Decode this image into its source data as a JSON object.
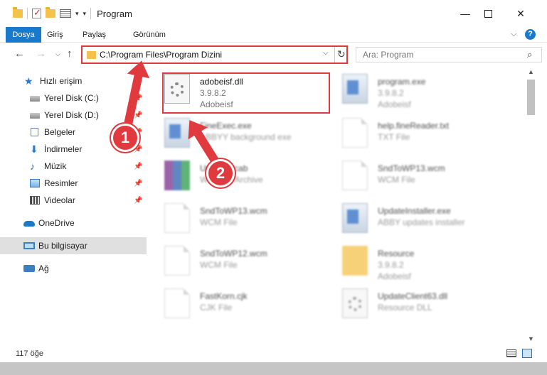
{
  "window": {
    "title": "Program",
    "controls": {
      "minimize": "—",
      "maximize": "",
      "close": "✕"
    }
  },
  "ribbon": {
    "tabs": [
      "Dosya",
      "Giriş",
      "Paylaş",
      "Görünüm"
    ],
    "collapse": "⌵",
    "help": "?"
  },
  "nav": {
    "back": "←",
    "forward": "→",
    "history": "⌵",
    "up": "↑",
    "address": "C:\\Program Files\\Program Dizini",
    "address_dropdown": "⌵",
    "refresh": "↻",
    "search_placeholder": "Ara: Program",
    "search_icon": "search-icon"
  },
  "sidebar": {
    "items": [
      {
        "label": "Hızlı erişim",
        "icon": "star-icon"
      },
      {
        "label": "Yerel Disk (C:)",
        "icon": "disk-icon",
        "pinned": true
      },
      {
        "label": "Yerel Disk (D:)",
        "icon": "disk-icon",
        "pinned": true
      },
      {
        "label": "Belgeler",
        "icon": "documents-icon",
        "pinned": true
      },
      {
        "label": "İndirmeler",
        "icon": "download-icon",
        "pinned": true
      },
      {
        "label": "Müzik",
        "icon": "music-icon",
        "pinned": true
      },
      {
        "label": "Resimler",
        "icon": "pictures-icon",
        "pinned": true
      },
      {
        "label": "Videolar",
        "icon": "videos-icon",
        "pinned": true
      },
      {
        "label": "OneDrive",
        "icon": "cloud-icon"
      },
      {
        "label": "Bu bilgisayar",
        "icon": "computer-icon",
        "selected": true
      },
      {
        "label": "Ağ",
        "icon": "network-icon"
      }
    ],
    "pin_glyph": "📌"
  },
  "files": [
    {
      "name": "adobeisf.dll",
      "line1": "3.9.8.2",
      "line2": "Adobeisf",
      "icon": "dll-gear-icon"
    },
    {
      "name": "program.exe",
      "line1": "3.9.8.2",
      "line2": "Adobeisf",
      "icon": "exe-icon"
    },
    {
      "name": "FineExec.exe",
      "line1": "ABBYY background exe",
      "line2": "",
      "icon": "exe-icon"
    },
    {
      "name": "help.fineReader.txt",
      "line1": "TXT File",
      "line2": "",
      "icon": "text-file-icon"
    },
    {
      "name": "Updates.cab",
      "line1": "WinRAR Archive",
      "line2": "",
      "icon": "archive-icon"
    },
    {
      "name": "SndToWP13.wcm",
      "line1": "WCM File",
      "line2": "",
      "icon": "file-icon"
    },
    {
      "name": "SndToWP13.wcm",
      "line1": "WCM File",
      "line2": "",
      "icon": "file-icon"
    },
    {
      "name": "UpdateInstaller.exe",
      "line1": "ABBY updates installer",
      "line2": "",
      "icon": "exe-icon"
    },
    {
      "name": "SndToWP12.wcm",
      "line1": "WCM File",
      "line2": "",
      "icon": "file-icon"
    },
    {
      "name": "Resource",
      "line1": "3.9.8.2",
      "line2": "Adobeisf",
      "icon": "folder-icon"
    },
    {
      "name": "FastKorn.cjk",
      "line1": "CJK File",
      "line2": "",
      "icon": "file-icon"
    },
    {
      "name": "UpdateClient63.dll",
      "line1": "Resource DLL",
      "line2": "",
      "icon": "dll-gear-icon"
    }
  ],
  "status": {
    "item_count": "117 öğe"
  },
  "annotations": {
    "badge1": "1",
    "badge2": "2"
  },
  "colors": {
    "accent": "#1979ca",
    "highlight": "#e0393e"
  }
}
